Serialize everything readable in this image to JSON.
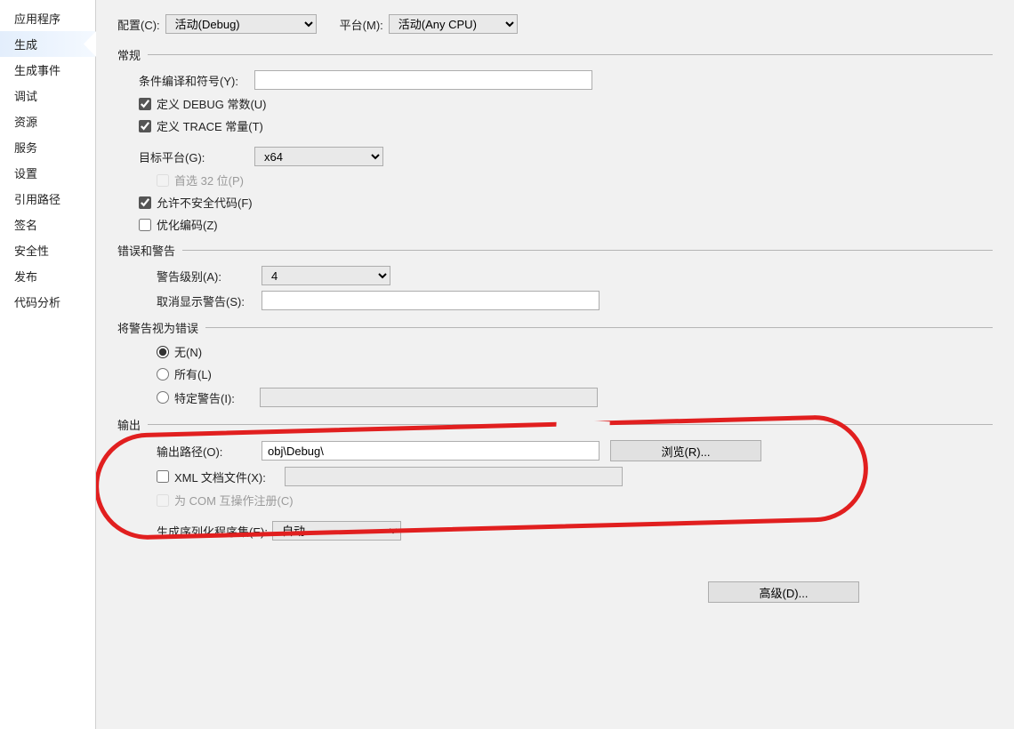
{
  "sidebar": {
    "items": [
      {
        "label": "应用程序"
      },
      {
        "label": "生成",
        "selected": true
      },
      {
        "label": "生成事件"
      },
      {
        "label": "调试"
      },
      {
        "label": "资源"
      },
      {
        "label": "服务"
      },
      {
        "label": "设置"
      },
      {
        "label": "引用路径"
      },
      {
        "label": "签名"
      },
      {
        "label": "安全性"
      },
      {
        "label": "发布"
      },
      {
        "label": "代码分析"
      }
    ]
  },
  "top": {
    "config_label": "配置(C):",
    "config_value": "活动(Debug)",
    "platform_label": "平台(M):",
    "platform_value": "活动(Any CPU)"
  },
  "sections": {
    "general": "常规",
    "errors": "错误和警告",
    "treat": "将警告视为错误",
    "output": "输出"
  },
  "general": {
    "cond_label": "条件编译和符号(Y):",
    "cond_value": "",
    "def_debug": "定义 DEBUG 常数(U)",
    "def_trace": "定义 TRACE 常量(T)",
    "target_label": "目标平台(G):",
    "target_value": "x64",
    "prefer32": "首选 32 位(P)",
    "allow_unsafe": "允许不安全代码(F)",
    "optimize": "优化编码(Z)"
  },
  "errors": {
    "level_label": "警告级别(A):",
    "level_value": "4",
    "suppress_label": "取消显示警告(S):",
    "suppress_value": ""
  },
  "treat": {
    "none": "无(N)",
    "all": "所有(L)",
    "specific": "特定警告(I):",
    "specific_value": ""
  },
  "output": {
    "path_label": "输出路径(O):",
    "path_value": "obj\\Debug\\",
    "browse": "浏览(R)...",
    "xml_doc": "XML 文档文件(X):",
    "xml_doc_value": "",
    "com_reg": "为 COM 互操作注册(C)",
    "serial_label": "生成序列化程序集(E):",
    "serial_value": "自动"
  },
  "advanced": "高级(D)..."
}
